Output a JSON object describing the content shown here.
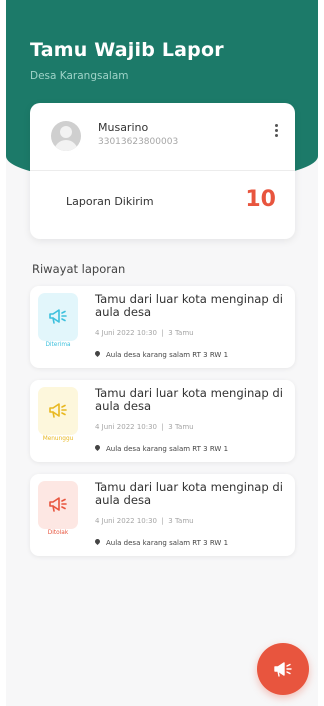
{
  "app": {
    "title": "Tamu Wajib Lapor",
    "subtitle": "Desa Karangsalam"
  },
  "profile": {
    "name": "Musarino",
    "id_number": "33013623800003",
    "menu_icon": "more-vertical-icon"
  },
  "stats": {
    "label": "Laporan Dikirim",
    "value": "10",
    "value_color": "#e8553e"
  },
  "history": {
    "title": "Riwayat laporan",
    "items": [
      {
        "title": "Tamu dari luar kota menginap di aula desa",
        "date": "4 Juni 2022 10:30",
        "guests": "3 Tamu",
        "location": "Aula desa karang salam RT 3 RW 1",
        "status": "Diterima",
        "icon": "megaphone-icon",
        "status_bg": "#e2f6fb",
        "status_color": "#3cc0dd"
      },
      {
        "title": "Tamu dari luar kota menginap di aula desa",
        "date": "4 Juni 2022 10:30",
        "guests": "3 Tamu",
        "location": "Aula desa karang salam RT 3 RW 1",
        "status": "Menunggu",
        "icon": "megaphone-icon",
        "status_bg": "#fdf7dc",
        "status_color": "#e8b820"
      },
      {
        "title": "Tamu dari luar kota menginap di aula desa",
        "date": "4 Juni 2022 10:30",
        "guests": "3 Tamu",
        "location": "Aula desa karang salam RT 3 RW 1",
        "status": "Ditolak",
        "icon": "megaphone-icon",
        "status_bg": "#fde7e3",
        "status_color": "#e8553e"
      }
    ]
  },
  "fab": {
    "icon": "megaphone-icon",
    "color": "#e8553e"
  },
  "colors": {
    "header": "#1c7a69",
    "background": "#f7f7f8"
  }
}
